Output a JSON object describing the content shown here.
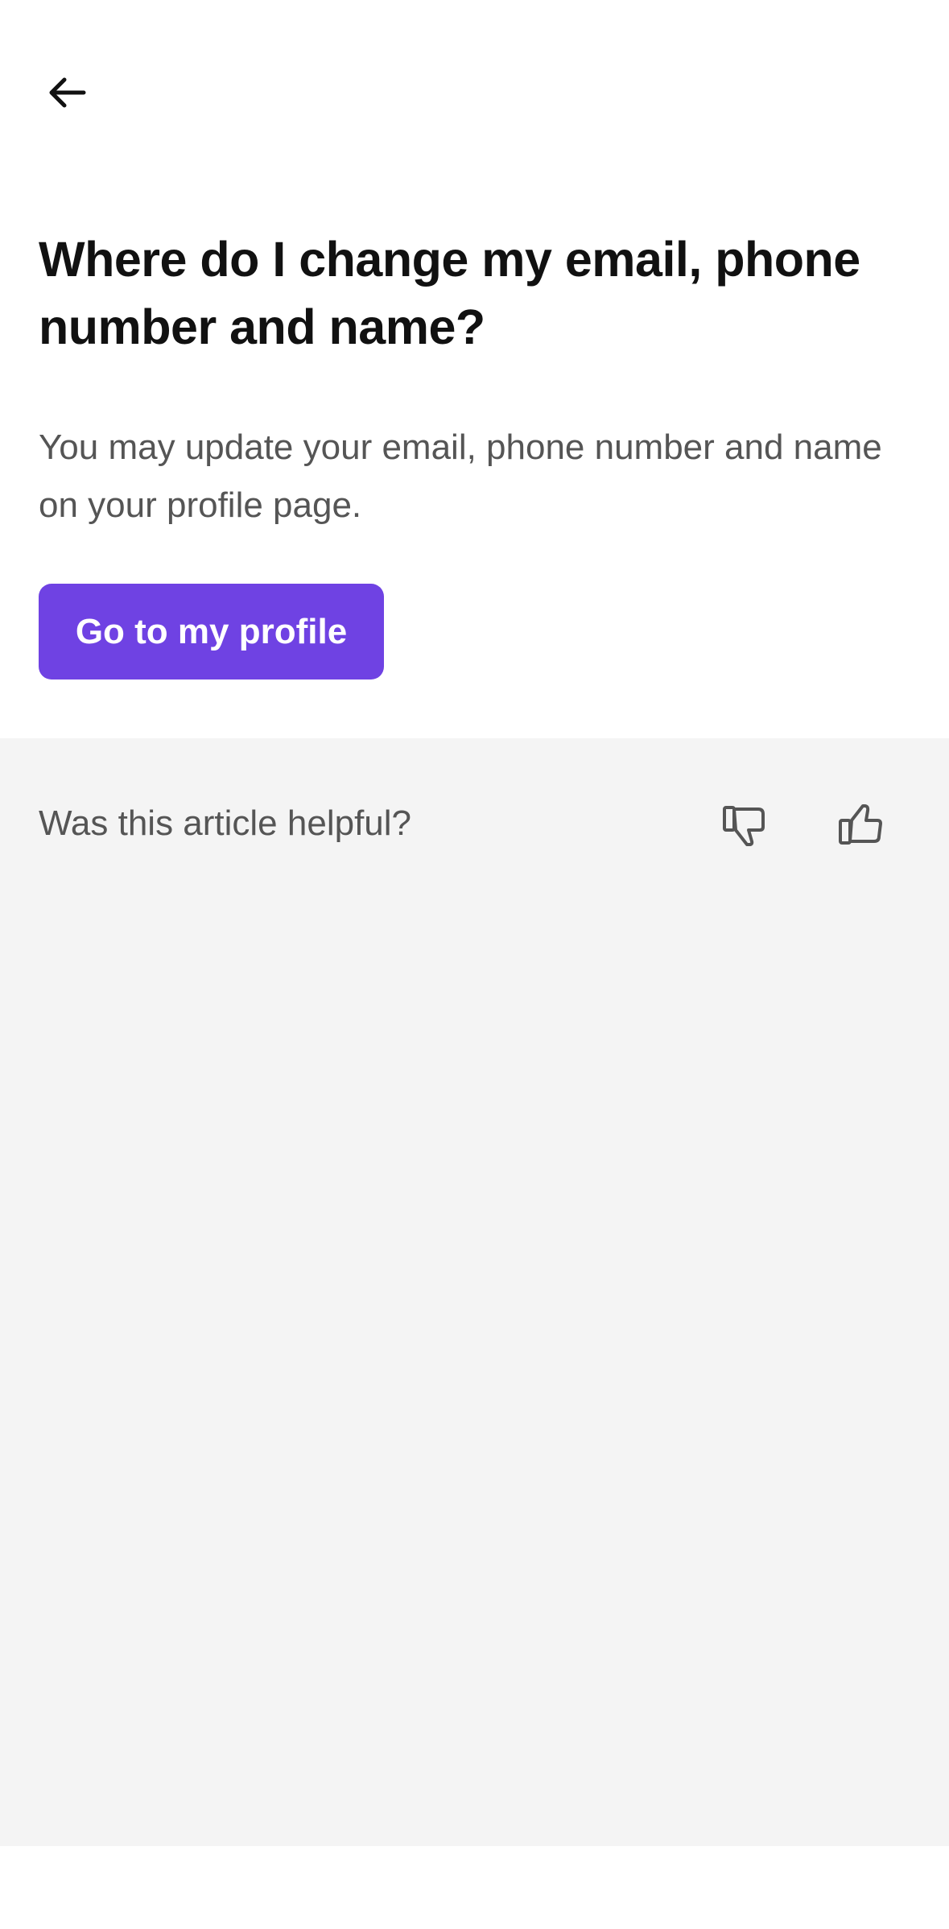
{
  "header": {
    "back_icon": "arrow-left-icon"
  },
  "article": {
    "title": "Where do I change my email, phone number and name?",
    "body": "You may update your email, phone number and name on your profile page.",
    "cta_label": "Go to my profile"
  },
  "feedback": {
    "question": "Was this article helpful?",
    "thumbs_down_icon": "thumbs-down-icon",
    "thumbs_up_icon": "thumbs-up-icon"
  },
  "colors": {
    "accent": "#6f42e3",
    "feedback_background": "#f4f4f4",
    "title_text": "#111111",
    "body_text": "#555555"
  }
}
